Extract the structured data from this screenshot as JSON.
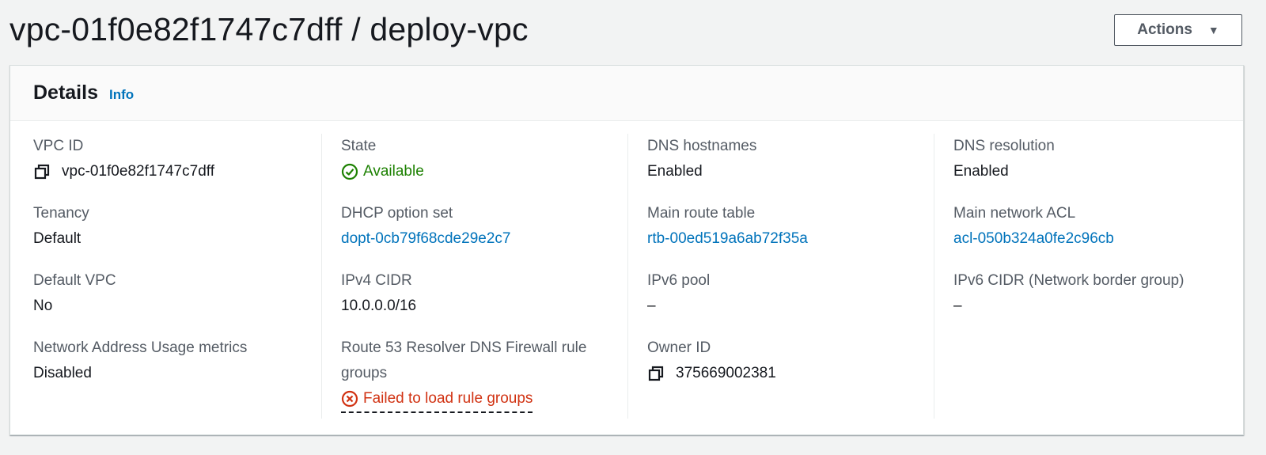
{
  "header": {
    "title": "vpc-01f0e82f1747c7dff / deploy-vpc",
    "actions_label": "Actions"
  },
  "panel": {
    "title": "Details",
    "info_label": "Info"
  },
  "fields": {
    "vpc_id": {
      "label": "VPC ID",
      "value": "vpc-01f0e82f1747c7dff"
    },
    "tenancy": {
      "label": "Tenancy",
      "value": "Default"
    },
    "default_vpc": {
      "label": "Default VPC",
      "value": "No"
    },
    "nau_metrics": {
      "label": "Network Address Usage metrics",
      "value": "Disabled"
    },
    "state": {
      "label": "State",
      "value": "Available"
    },
    "dhcp": {
      "label": "DHCP option set",
      "value": "dopt-0cb79f68cde29e2c7"
    },
    "ipv4_cidr": {
      "label": "IPv4 CIDR",
      "value": "10.0.0.0/16"
    },
    "route53": {
      "label": "Route 53 Resolver DNS Firewall rule groups",
      "value": "Failed to load rule groups"
    },
    "dns_hostnames": {
      "label": "DNS hostnames",
      "value": "Enabled"
    },
    "main_route_table": {
      "label": "Main route table",
      "value": "rtb-00ed519a6ab72f35a"
    },
    "ipv6_pool": {
      "label": "IPv6 pool",
      "value": "–"
    },
    "owner_id": {
      "label": "Owner ID",
      "value": "375669002381"
    },
    "dns_resolution": {
      "label": "DNS resolution",
      "value": "Enabled"
    },
    "main_acl": {
      "label": "Main network ACL",
      "value": "acl-050b324a0fe2c96cb"
    },
    "ipv6_cidr": {
      "label": "IPv6 CIDR (Network border group)",
      "value": "–"
    }
  },
  "colors": {
    "link": "#0073bb",
    "success": "#1d8102",
    "error": "#d13212",
    "label": "#545b64",
    "text": "#16191f"
  },
  "icons": {
    "copy": "copy-icon",
    "status_success": "check-circle-icon",
    "status_error": "x-circle-icon",
    "actions_caret": "caret-down-icon"
  }
}
